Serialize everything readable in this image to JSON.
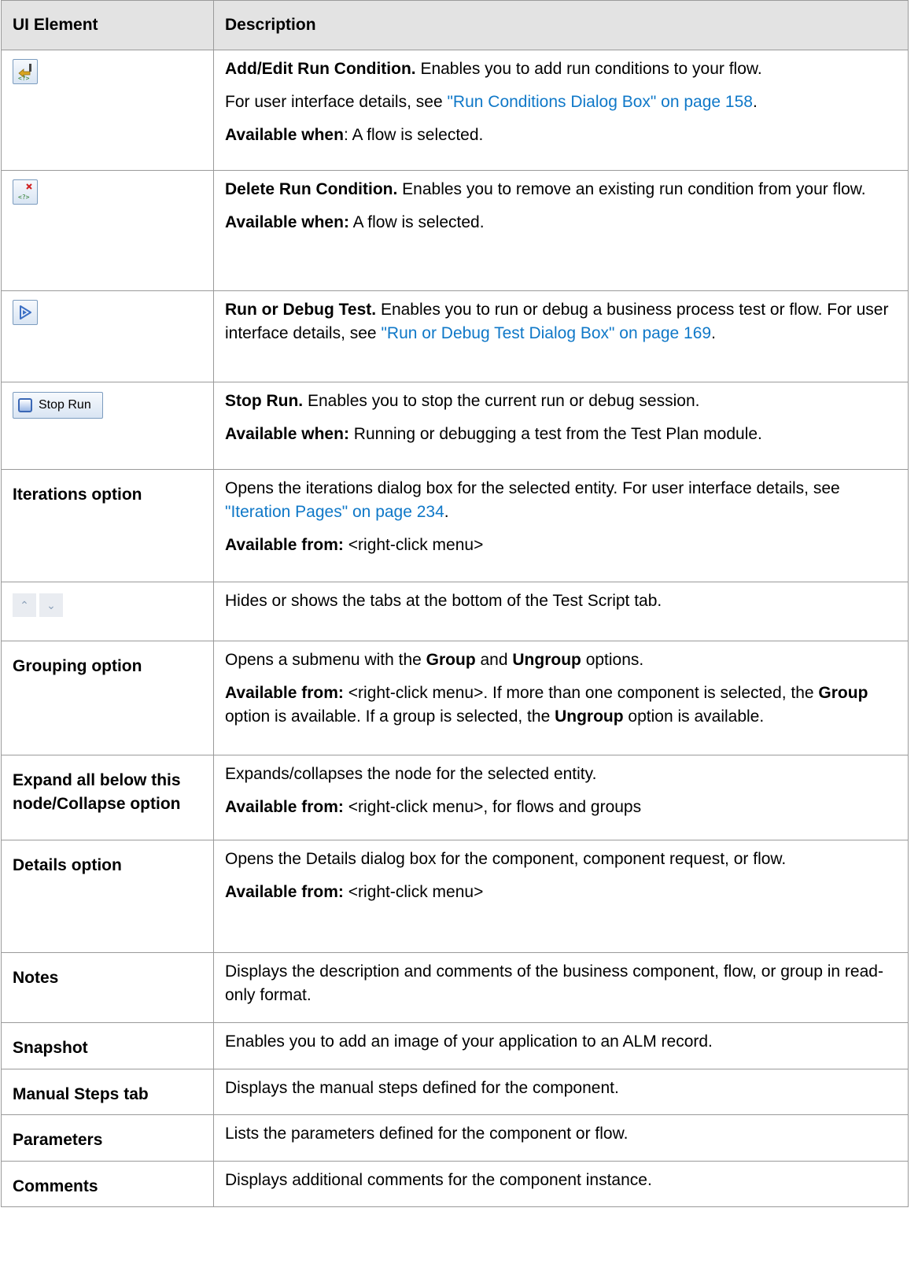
{
  "header": {
    "col_element": "UI Element",
    "col_description": "Description"
  },
  "rows": {
    "add_edit": {
      "icon": "add-run-condition-icon",
      "title": "Add/Edit Run Condition.",
      "text": " Enables you to add run conditions to your flow.",
      "ui_prefix": "For user interface details, see ",
      "ui_link": "\"Run Conditions Dialog Box\" on page 158",
      "ui_suffix": ".",
      "avail_label": "Available when",
      "avail_text": ": A flow is selected."
    },
    "delete": {
      "icon": "delete-run-condition-icon",
      "title": "Delete Run Condition.",
      "text": " Enables you to remove an existing run condition from your flow.",
      "avail_label": "Available when:",
      "avail_text": " A flow is selected."
    },
    "run_debug": {
      "icon": "run-debug-icon",
      "title": "Run or Debug Test.",
      "text": " Enables you to run or debug a business process test or flow. For user interface details, see ",
      "link": "\"Run or Debug Test Dialog Box\" on page 169",
      "suffix": "."
    },
    "stop_run": {
      "button_label": "Stop Run",
      "title": "Stop Run.",
      "text": " Enables you to stop the current run or debug session.",
      "avail_label": "Available when:",
      "avail_text": " Running or debugging a test from the Test Plan module."
    },
    "iterations": {
      "element": "Iterations option",
      "text": "Opens the iterations dialog box for the selected entity. For user interface details, see ",
      "link": "\"Iteration Pages\" on page 234",
      "suffix": ".",
      "avail_label": "Available from:",
      "avail_text": " <right-click menu>"
    },
    "hide_show": {
      "up_glyph": "≈",
      "down_glyph": "≈",
      "text": "Hides or shows the tabs at the bottom of the Test Script tab."
    },
    "grouping": {
      "element": "Grouping option",
      "t1": "Opens a submenu with the ",
      "b1": "Group",
      "t2": " and ",
      "b2": "Ungroup",
      "t3": " options.",
      "avail_label": "Available from:",
      "a1": " <right-click menu>. If more than one component is selected, the ",
      "ab1": "Group",
      "a2": " option is available. If a group is selected, the ",
      "ab2": "Ungroup",
      "a3": " option is available."
    },
    "expand": {
      "element": "Expand all below this node/Collapse option",
      "text": "Expands/collapses the node for the selected entity.",
      "avail_label": "Available from:",
      "avail_text": " <right-click menu>, for flows and groups"
    },
    "details": {
      "element": "Details option",
      "text": "Opens the Details dialog box for the component, component request, or flow.",
      "avail_label": "Available from:",
      "avail_text": " <right-click menu>"
    },
    "notes": {
      "element": "Notes",
      "text": "Displays the description and comments of the business component, flow, or group in read-only format."
    },
    "snapshot": {
      "element": "Snapshot",
      "text": "Enables you to add an image of your application to an ALM record."
    },
    "manual_steps": {
      "element": "Manual Steps tab",
      "text": "Displays the manual steps defined for the component."
    },
    "parameters": {
      "element": "Parameters",
      "text": "Lists the parameters defined for the component or flow."
    },
    "comments": {
      "element": "Comments",
      "text": "Displays additional comments for the component instance."
    }
  },
  "colors": {
    "link": "#0f78c8",
    "header_bg": "#e3e3e3",
    "border": "#9a9a9a"
  }
}
